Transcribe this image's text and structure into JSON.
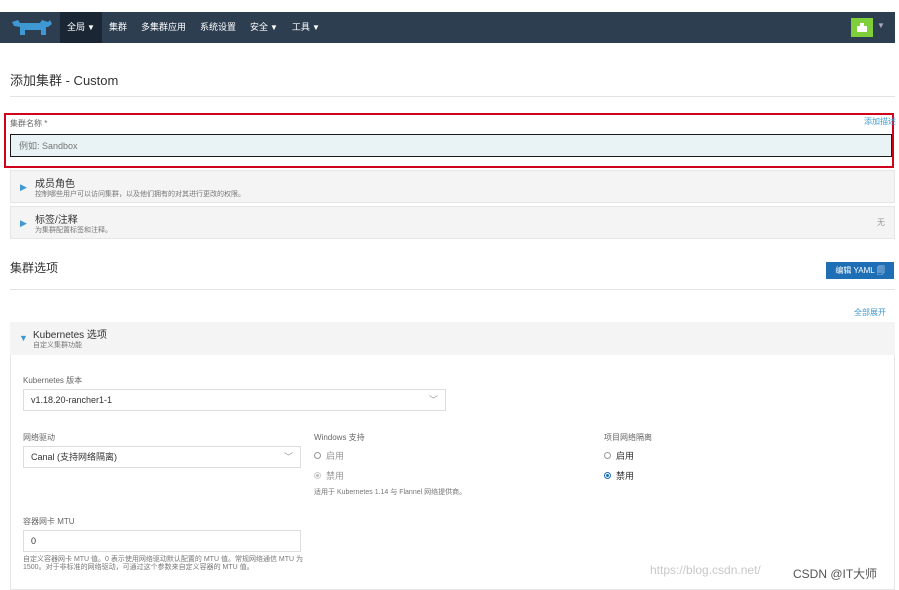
{
  "nav": {
    "items": [
      {
        "label": "全局",
        "dropdown": true,
        "active": true
      },
      {
        "label": "集群",
        "dropdown": false
      },
      {
        "label": "多集群应用",
        "dropdown": false
      },
      {
        "label": "系统设置",
        "dropdown": false
      },
      {
        "label": "安全",
        "dropdown": true
      },
      {
        "label": "工具",
        "dropdown": true
      }
    ],
    "chevron": "⌄"
  },
  "page": {
    "title": "添加集群 - Custom"
  },
  "cluster_name": {
    "label": "集群名称 *",
    "placeholder": "例如: Sandbox",
    "add_description": "添加描述"
  },
  "accordions": {
    "members": {
      "title": "成员角色",
      "subtitle": "控制哪些用户可以访问集群，以及他们拥有的对其进行更改的权限。"
    },
    "labels": {
      "title": "标签/注释",
      "subtitle": "为集群配置标签和注释。",
      "right": "无"
    }
  },
  "cluster_options": {
    "title": "集群选项",
    "edit_yaml": "编辑 YAML 🗐",
    "expand_all": "全部展开"
  },
  "k8s": {
    "title": "Kubernetes 选项",
    "subtitle": "自定义集群功能",
    "version_label": "Kubernetes 版本",
    "version_value": "v1.18.20-rancher1-1",
    "network_label": "网络驱动",
    "network_value": "Canal (支持网络隔离)",
    "windows_label": "Windows 支持",
    "windows_enable": "启用",
    "windows_disable": "禁用",
    "windows_help": "适用于 Kubernetes 1.14 与 Flannel 网络提供商。",
    "isolation_label": "项目网络隔离",
    "isolation_enable": "启用",
    "isolation_disable": "禁用",
    "mtu_label": "容器网卡 MTU",
    "mtu_value": "0",
    "mtu_help": "自定义容器网卡 MTU 值。0 表示使用网络驱动默认配置的 MTU 值。常规网络通信 MTU 为 1500。对于非标准的网络驱动，可通过这个参数来自定义容器的 MTU 值。"
  },
  "watermark": {
    "url": "https://blog.csdn.net/",
    "brand": "CSDN @IT大师"
  },
  "colors": {
    "topbar": "#2d3e50",
    "accent": "#3d98d3",
    "button": "#1e6fb5",
    "highlight": "#d0021b"
  }
}
